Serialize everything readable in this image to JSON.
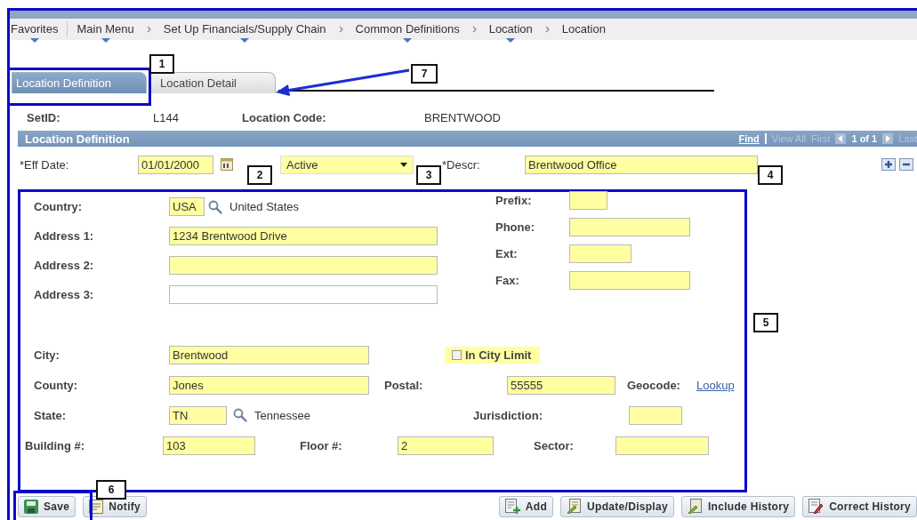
{
  "breadcrumbs": [
    {
      "label": "Favorites",
      "has_menu": true
    },
    {
      "label": "Main Menu",
      "has_menu": true
    },
    {
      "label": "Set Up Financials/Supply Chain",
      "has_menu": true
    },
    {
      "label": "Common Definitions",
      "has_menu": true
    },
    {
      "label": "Location",
      "has_menu": true
    },
    {
      "label": "Location",
      "has_menu": false
    }
  ],
  "tabs": [
    {
      "label": "Location Definition",
      "selected": true
    },
    {
      "label": "Location Detail",
      "selected": false
    }
  ],
  "header": {
    "setid_label": "SetID:",
    "setid": "L144",
    "code_label": "Location Code:",
    "code": "BRENTWOOD"
  },
  "section": {
    "title": "Location Definition",
    "find": "Find",
    "view_all": "View All",
    "first": "First",
    "count": "1 of 1",
    "last": "Last"
  },
  "effective": {
    "date_label": "*Eff Date:",
    "date": "01/01/2000",
    "status": "Active",
    "descr_label": "*Descr:",
    "descr": "Brentwood Office"
  },
  "address": {
    "country": {
      "label": "Country:",
      "value": "USA",
      "description": "United States"
    },
    "address_1": {
      "label": "Address 1:",
      "value": "1234 Brentwood Drive",
      "highlighted": true
    },
    "address_2": {
      "label": "Address 2:",
      "highlighted": true
    },
    "address_3": {
      "label": "Address 3:",
      "highlighted": false
    },
    "prefix": {
      "label": "Prefix:"
    },
    "phone": {
      "label": "Phone:"
    },
    "ext": {
      "label": "Ext:"
    },
    "fax": {
      "label": "Fax:"
    },
    "city": {
      "label": "City:",
      "value": "Brentwood"
    },
    "in_city_limit": {
      "label": "In City Limit",
      "checked": false
    },
    "county": {
      "label": "County:",
      "value": "Jones"
    },
    "postal": {
      "label": "Postal:",
      "value": "55555"
    },
    "geocode": {
      "label": "Geocode:",
      "link": "Lookup"
    },
    "state": {
      "label": "State:",
      "value": "TN",
      "description": "Tennessee"
    },
    "jurisdiction": {
      "label": "Jurisdiction:"
    },
    "building": {
      "label": "Building #:",
      "value": "103"
    },
    "floor": {
      "label": "Floor #:",
      "value": "2"
    },
    "sector": {
      "label": "Sector:"
    }
  },
  "toolbar": {
    "left": [
      {
        "label": "Save",
        "kind": "save"
      },
      {
        "label": "Notify",
        "kind": "notify"
      }
    ],
    "right": [
      {
        "label": "Add",
        "kind": "add"
      },
      {
        "label": "Update/Display",
        "kind": "update"
      },
      {
        "label": "Include History",
        "kind": "include"
      },
      {
        "label": "Correct History",
        "kind": "correct"
      }
    ]
  },
  "annotations": [
    {
      "label": "1"
    },
    {
      "label": "7"
    },
    {
      "label": "2"
    },
    {
      "label": "3"
    },
    {
      "label": "4"
    },
    {
      "label": "5"
    },
    {
      "label": "6"
    }
  ]
}
